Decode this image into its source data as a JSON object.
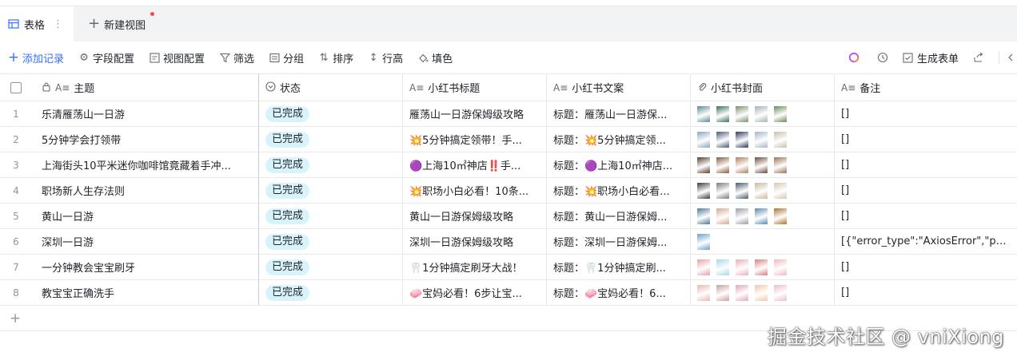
{
  "tabs": {
    "active_label": "表格",
    "active_more": "⋮",
    "new_view_label": "新建视图"
  },
  "toolbar": {
    "add_record": "添加记录",
    "field_config": "字段配置",
    "view_config": "视图配置",
    "filter": "筛选",
    "group": "分组",
    "sort": "排序",
    "row_height": "行高",
    "fill_color": "填色",
    "generate_form": "生成表单"
  },
  "columns": {
    "subject": "主题",
    "status": "状态",
    "xhs_title": "小红书标题",
    "xhs_copy": "小红书文案",
    "xhs_cover": "小红书封面",
    "note": "备注"
  },
  "rows": [
    {
      "no": "1",
      "subject": "乐清雁荡山一日游",
      "status": "已完成",
      "title": "雁荡山一日游保姆级攻略",
      "copy": "标题：雁荡山一日游保...",
      "note": "[]",
      "thumbs": [
        "#5b8a9a",
        "#3e6d5c",
        "#7c8f6a",
        "#a4b0b5",
        "#6a8a5a"
      ]
    },
    {
      "no": "2",
      "subject": "5分钟学会打领带",
      "status": "已完成",
      "title": "💥5分钟搞定领带！手...",
      "copy": "标题：💥5分钟搞定领...",
      "note": "[]",
      "thumbs": [
        "#8aa4c4",
        "#4a5a7a",
        "#2e3a5a",
        "#a8b4c8",
        "#c8bfae"
      ]
    },
    {
      "no": "3",
      "subject": "上海街头10平米迷你咖啡馆竟藏着手冲...",
      "status": "已完成",
      "title": "🟣上海10㎡神店‼️手...",
      "copy": "标题：🟣上海10㎡神店...",
      "note": "[]",
      "thumbs": [
        "#5a3a2a",
        "#8a5a3a",
        "#b08060",
        "#6a4a3a",
        "#9a7050"
      ]
    },
    {
      "no": "4",
      "subject": "职场新人生存法则",
      "status": "已完成",
      "title": "💥职场小白必看！10条...",
      "copy": "标题：💥职场小白必看...",
      "note": "[]",
      "thumbs": [
        "#3a3a3a",
        "#7a7a7a",
        "#4a5a6a",
        "#c8b8a0",
        "#d8c8b0"
      ]
    },
    {
      "no": "5",
      "subject": "黄山一日游",
      "status": "已完成",
      "title": "黄山一日游保姆级攻略",
      "copy": "标题：黄山一日游保姆...",
      "note": "[]",
      "thumbs": [
        "#4a7a9a",
        "#d8a890",
        "#9aa0a8",
        "#5a8ab0",
        "#b07030"
      ]
    },
    {
      "no": "6",
      "subject": "深圳一日游",
      "status": "已完成",
      "title": "深圳一日游保姆级攻略",
      "copy": "标题：深圳一日游保姆...",
      "note": "[{\"error_type\":\"AxiosError\",\"page_i",
      "thumbs": [
        "#6aa0c8"
      ]
    },
    {
      "no": "7",
      "subject": "一分钟教会宝宝刷牙",
      "status": "已完成",
      "title": "🦷1分钟搞定刷牙大战！",
      "copy": "标题：🦷1分钟搞定刷...",
      "note": "[]",
      "thumbs": [
        "#e8a0a8",
        "#a8d8e8",
        "#e8b0b8",
        "#d88080",
        "#f0b8c0"
      ]
    },
    {
      "no": "8",
      "subject": "教宝宝正确洗手",
      "status": "已完成",
      "title": "🧼宝妈必看！6步让宝...",
      "copy": "标题：🧼宝妈必看！6...",
      "note": "[]",
      "thumbs": [
        "#e8b8b0",
        "#c8a0a0",
        "#e0a8b8",
        "#f0c8a8",
        "#e8c0c8"
      ]
    }
  ],
  "watermark": "掘金技术社区 @ vniXiong",
  "colors": {
    "accent": "#3370ff",
    "status_tag": "#d9f3fd",
    "red_dot": "#f54a45"
  }
}
